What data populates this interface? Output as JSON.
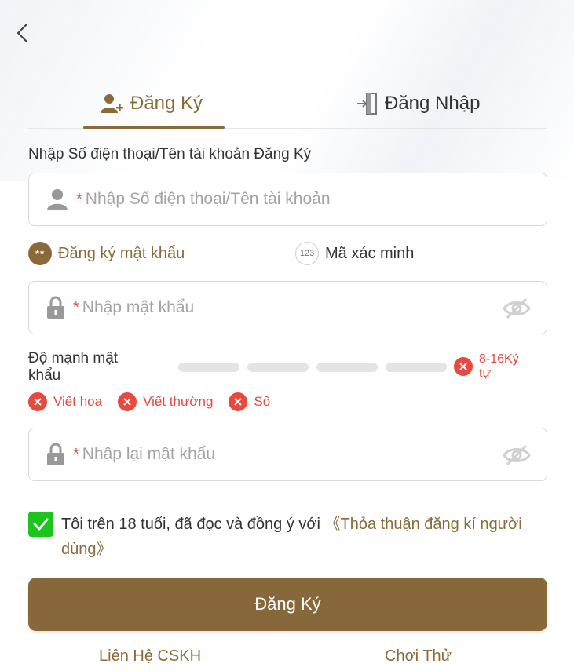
{
  "tabs": {
    "register": "Đăng Ký",
    "login": "Đăng Nhập"
  },
  "form": {
    "section_label": "Nhập Số điện thoại/Tên tài khoản Đăng Ký",
    "required_mark": "*",
    "username_placeholder": "Nhập Số điện thoại/Tên tài khoản",
    "password_placeholder": "Nhập mật khẩu",
    "confirm_placeholder": "Nhập lại mật khẩu"
  },
  "modes": {
    "password": {
      "icon_text": "**",
      "label": "Đăng ký mật khẩu"
    },
    "code": {
      "icon_text": "123",
      "label": "Mã xác minh"
    }
  },
  "strength": {
    "label": "Độ mạnh mật khẩu",
    "length_rule": "8-16Ký tự",
    "rules": [
      "Viết hoa",
      "Viết thường",
      "Số"
    ]
  },
  "agreement": {
    "checked": true,
    "text": "Tôi trên 18 tuổi, đã đọc và đồng ý với ",
    "link": "《Thỏa thuận đăng kí người dùng》"
  },
  "submit_label": "Đăng Ký",
  "footer": {
    "support": "Liên Hệ CSKH",
    "try": "Chơi Thử"
  },
  "colors": {
    "brand": "#8a6a38",
    "error": "#e8493f",
    "check": "#1bc51b"
  }
}
